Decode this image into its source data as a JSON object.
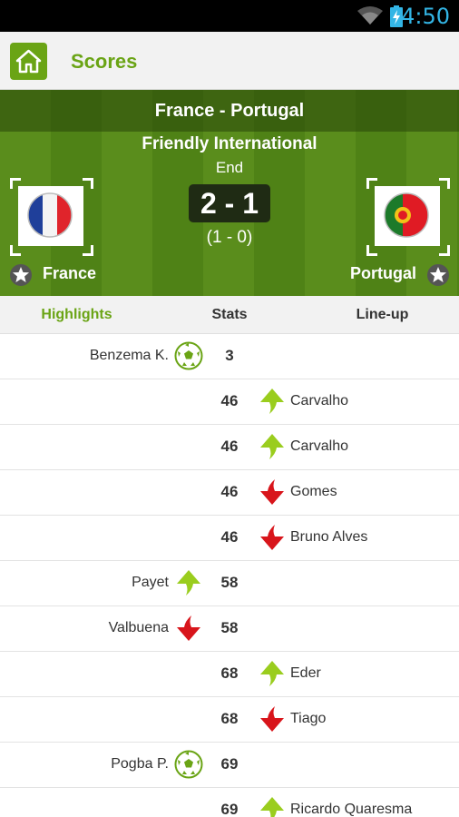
{
  "status_bar": {
    "time": "4:50"
  },
  "action_bar": {
    "title": "Scores"
  },
  "match": {
    "title": "France - Portugal",
    "competition": "Friendly International",
    "status": "End",
    "score": "2 - 1",
    "halftime": "(1 - 0)",
    "home_team": "France",
    "away_team": "Portugal"
  },
  "tabs": {
    "highlights": "Highlights",
    "stats": "Stats",
    "lineup": "Line-up"
  },
  "events": [
    {
      "minute": "3",
      "home": "Benzema K.",
      "away": "",
      "icon": "goal",
      "side": "home"
    },
    {
      "minute": "46",
      "home": "",
      "away": "Carvalho",
      "icon": "sub-in",
      "side": "away"
    },
    {
      "minute": "46",
      "home": "",
      "away": "Carvalho",
      "icon": "sub-in",
      "side": "away"
    },
    {
      "minute": "46",
      "home": "",
      "away": "Gomes",
      "icon": "sub-out",
      "side": "away"
    },
    {
      "minute": "46",
      "home": "",
      "away": "Bruno Alves",
      "icon": "sub-out",
      "side": "away"
    },
    {
      "minute": "58",
      "home": "Payet",
      "away": "",
      "icon": "sub-in",
      "side": "home"
    },
    {
      "minute": "58",
      "home": "Valbuena",
      "away": "",
      "icon": "sub-out",
      "side": "home"
    },
    {
      "minute": "68",
      "home": "",
      "away": "Eder",
      "icon": "sub-in",
      "side": "away"
    },
    {
      "minute": "68",
      "home": "",
      "away": "Tiago",
      "icon": "sub-out",
      "side": "away"
    },
    {
      "minute": "69",
      "home": "Pogba P.",
      "away": "",
      "icon": "goal",
      "side": "home"
    },
    {
      "minute": "69",
      "home": "",
      "away": "Ricardo Quaresma",
      "icon": "sub-in",
      "side": "away"
    }
  ],
  "colors": {
    "accent": "#6aa415",
    "sub_in": "#9acd1e",
    "sub_out": "#d8151b",
    "clock": "#33b5e5"
  }
}
